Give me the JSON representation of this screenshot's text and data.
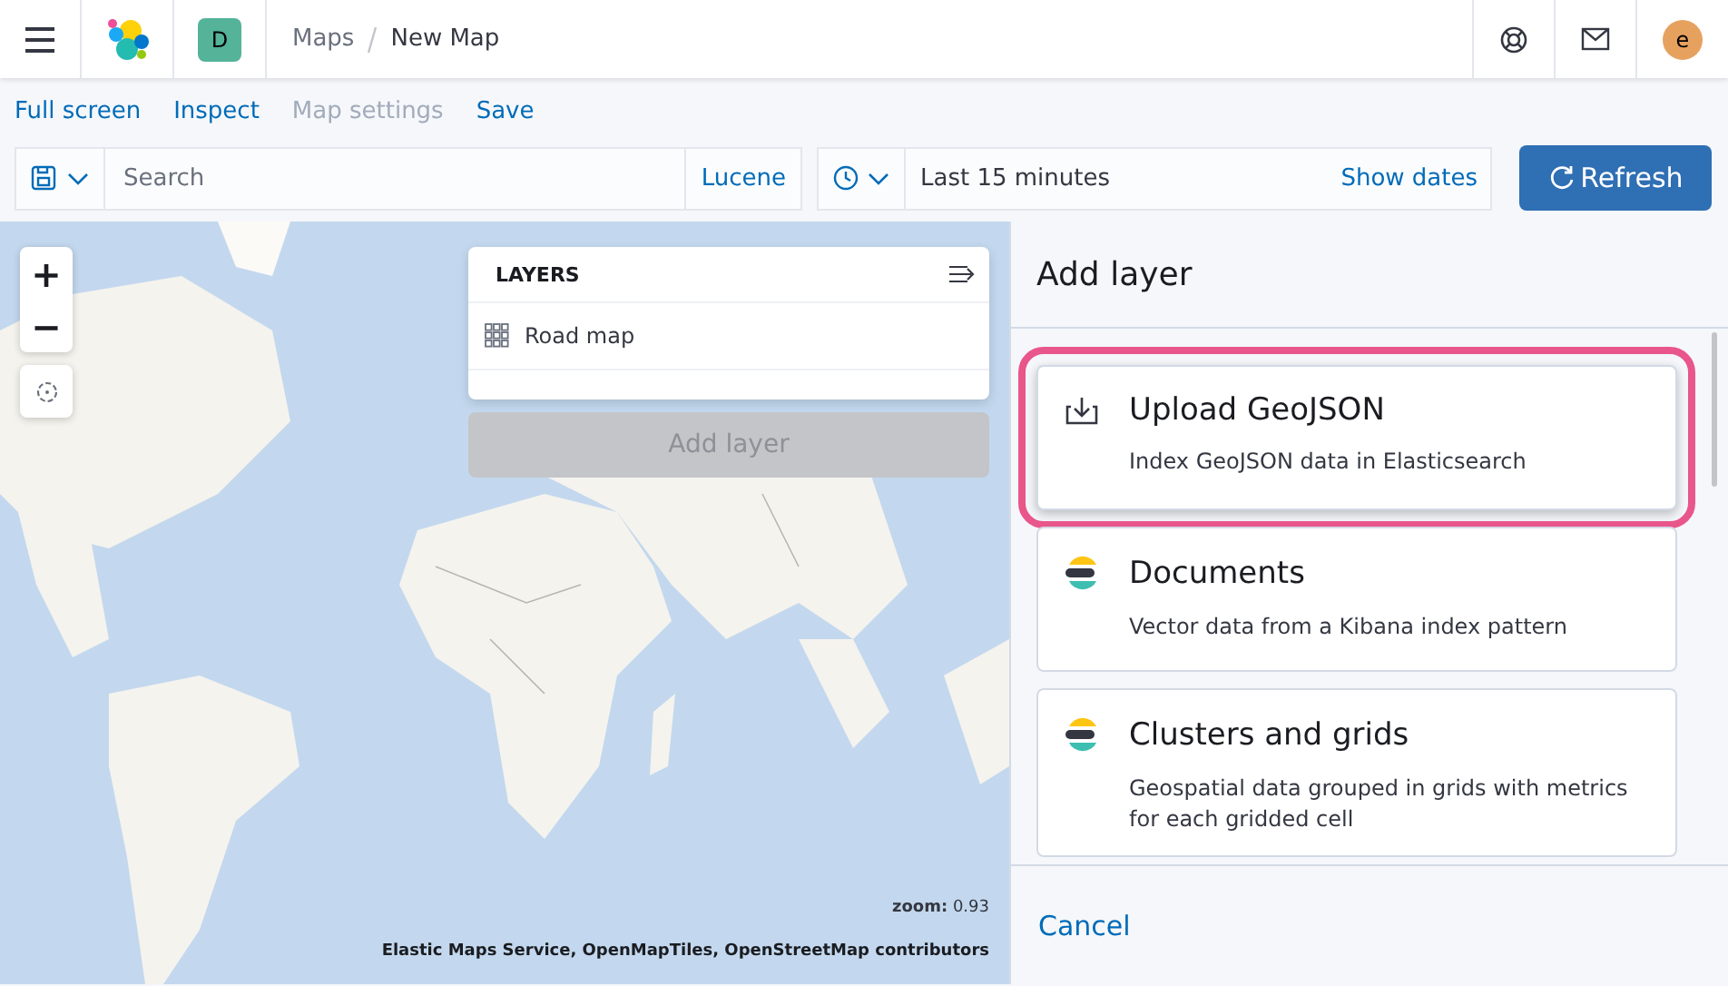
{
  "header": {
    "avatar_letter": "D",
    "breadcrumbs": [
      {
        "label": "Maps",
        "current": false
      },
      {
        "label": "New Map",
        "current": true
      }
    ],
    "user_initial": "e"
  },
  "top_menu": [
    {
      "label": "Full screen",
      "disabled": false
    },
    {
      "label": "Inspect",
      "disabled": false
    },
    {
      "label": "Map settings",
      "disabled": true
    },
    {
      "label": "Save",
      "disabled": false
    }
  ],
  "query_bar": {
    "placeholder": "Search",
    "language": "Lucene",
    "time_range": "Last 15 minutes",
    "show_dates": "Show dates",
    "refresh": "Refresh"
  },
  "map": {
    "kind": "picture",
    "zoom_label": "zoom:",
    "zoom_value": "0.93",
    "attribution": "Elastic Maps Service, OpenMapTiles, OpenStreetMap contributors",
    "controls": [
      {
        "label": "+"
      },
      {
        "label": "−"
      }
    ],
    "layers_panel": {
      "title": "LAYERS",
      "layers": [
        {
          "name": "Road map"
        }
      ],
      "add_button": "Add layer",
      "add_disabled": true
    }
  },
  "flyout": {
    "title": "Add layer",
    "cards": [
      {
        "kind": "upload",
        "title": "Upload GeoJSON",
        "description": "Index GeoJSON data in Elasticsearch",
        "highlighted": true
      },
      {
        "kind": "source",
        "title": "Documents",
        "description": "Vector data from a Kibana index pattern",
        "highlighted": false
      },
      {
        "kind": "source",
        "title": "Clusters and grids",
        "description": "Geospatial data grouped in grids with metrics for each gridded cell",
        "highlighted": false
      }
    ],
    "cancel": "Cancel"
  }
}
